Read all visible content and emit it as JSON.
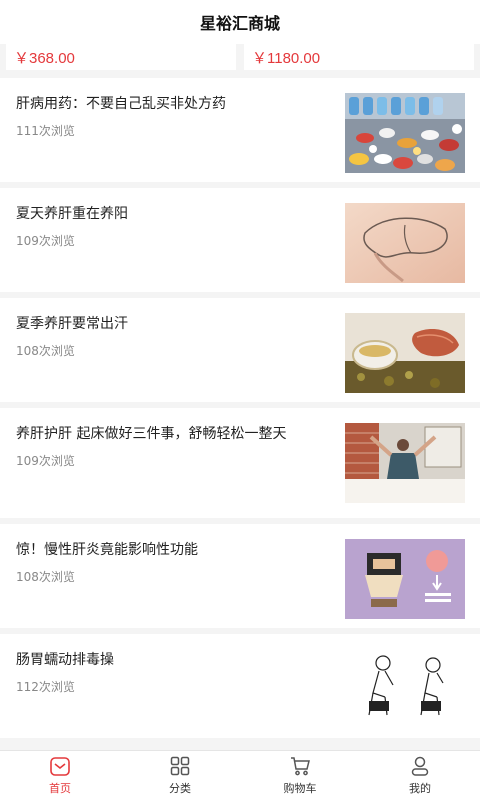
{
  "header": {
    "title": "星裕汇商城"
  },
  "prices": [
    "￥368.00",
    "￥1180.00"
  ],
  "articles": [
    {
      "title": "肝病用药：不要自己乱买非处方药",
      "views": "111次浏览",
      "image": "pills-image"
    },
    {
      "title": "夏天养肝重在养阳",
      "views": "109次浏览",
      "image": "liver-diagram-image"
    },
    {
      "title": "夏季养肝要常出汗",
      "views": "108次浏览",
      "image": "tea-liver-image"
    },
    {
      "title": "养肝护肝 起床做好三件事，舒畅轻松一整天",
      "views": "109次浏览",
      "image": "bedroom-stretch-image"
    },
    {
      "title": "惊！慢性肝炎竟能影响性功能",
      "views": "108次浏览",
      "image": "purple-cartoon-image"
    },
    {
      "title": "肠胃蠕动排毒操",
      "views": "112次浏览",
      "image": "squat-sketch-image"
    }
  ],
  "tabbar": {
    "home": "首页",
    "category": "分类",
    "cart": "购物车",
    "mine": "我的"
  },
  "colors": {
    "accent": "#e4393c"
  }
}
